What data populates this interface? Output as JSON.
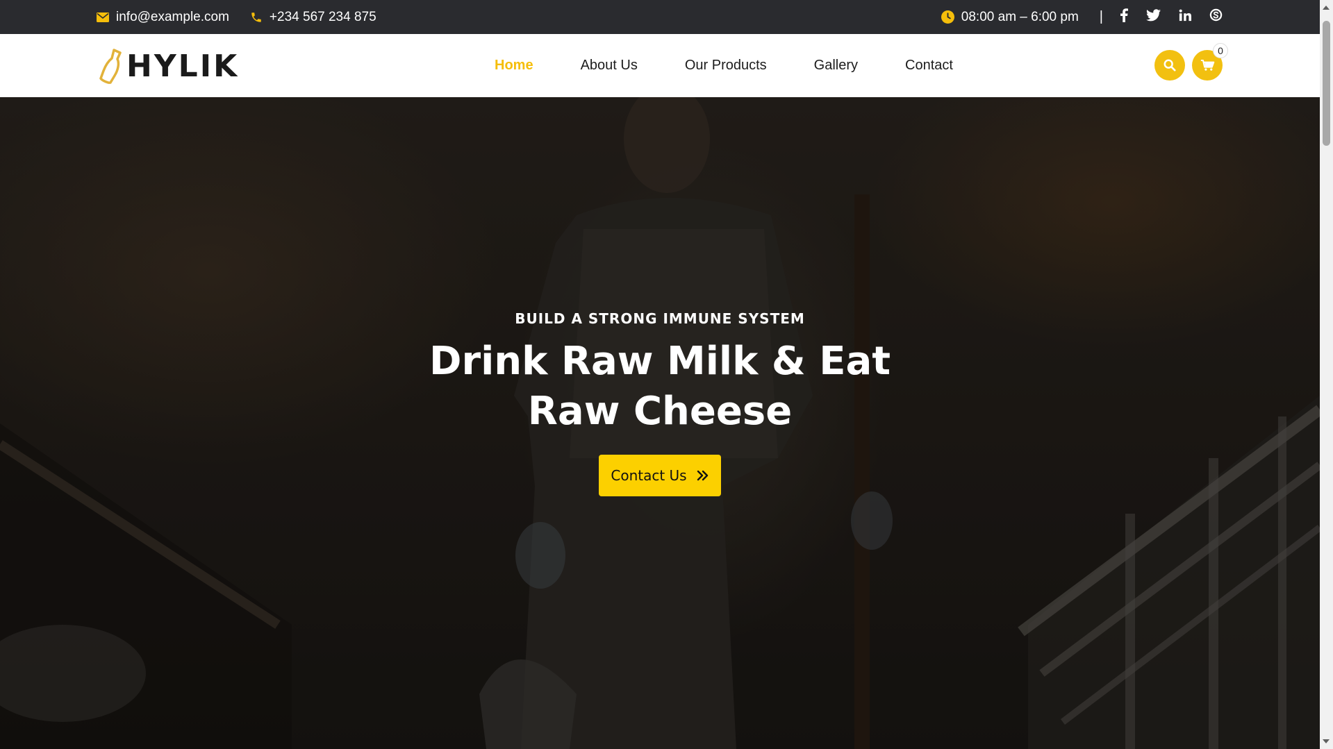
{
  "topbar": {
    "email": "info@example.com",
    "phone": "+234 567 234 875",
    "hours": "08:00 am – 6:00 pm",
    "separator": "|",
    "social": [
      "facebook-icon",
      "twitter-icon",
      "linkedin-icon",
      "skype-icon"
    ]
  },
  "header": {
    "logo_text": "HYLIK",
    "nav": [
      {
        "label": "Home",
        "active": true
      },
      {
        "label": "About Us"
      },
      {
        "label": "Our Products"
      },
      {
        "label": "Gallery"
      },
      {
        "label": "Contact"
      }
    ],
    "cart_count": "0"
  },
  "hero": {
    "kicker": "BUILD A STRONG IMMUNE SYSTEM",
    "headline_line1": "Drink Raw Milk & Eat",
    "headline_line2": "Raw Cheese",
    "cta_label": "Contact Us"
  },
  "colors": {
    "accent": "#f5be0b",
    "button": "#fcd000",
    "topbar_bg": "#2a2b2f"
  }
}
